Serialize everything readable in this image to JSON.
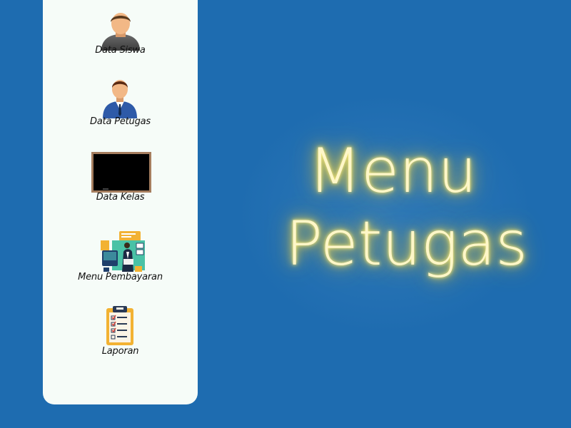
{
  "sidebar": {
    "items": [
      {
        "label": "Data Siswa",
        "icon": "student-user-icon"
      },
      {
        "label": "Data Petugas",
        "icon": "officer-user-icon"
      },
      {
        "label": "Data Kelas",
        "icon": "blackboard-icon"
      },
      {
        "label": "Menu Pembayaran",
        "icon": "payment-illustration-icon"
      },
      {
        "label": "Laporan",
        "icon": "clipboard-report-icon"
      }
    ]
  },
  "main": {
    "title_line1": "Menu",
    "title_line2": "Petugas"
  },
  "colors": {
    "background": "#1e6cb0",
    "sidebar": "#f6fcf8",
    "neon_text": "#fff7c8",
    "neon_glow": "#f7df55"
  }
}
